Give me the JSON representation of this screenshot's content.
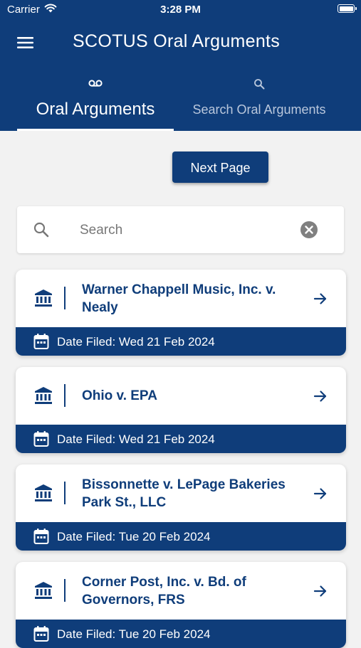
{
  "status_bar": {
    "carrier": "Carrier",
    "time": "3:28 PM"
  },
  "header": {
    "title": "SCOTUS Oral Arguments"
  },
  "tabs": [
    {
      "label": "Oral Arguments",
      "icon": "voicemail-icon",
      "active": true
    },
    {
      "label": "Search Oral Arguments",
      "icon": "search-icon",
      "active": false
    }
  ],
  "pagination": {
    "next_label": "Next Page"
  },
  "search": {
    "placeholder": "Search",
    "value": ""
  },
  "colors": {
    "primary": "#0f3d7a",
    "background": "#f2f2f2",
    "inactive_tab": "#b9c7dc"
  },
  "cases": [
    {
      "name": "Warner Chappell Music, Inc. v. Nealy",
      "date": "Date Filed: Wed 21 Feb 2024"
    },
    {
      "name": "Ohio v. EPA",
      "date": "Date Filed: Wed 21 Feb 2024"
    },
    {
      "name": "Bissonnette v. LePage Bakeries Park St., LLC",
      "date": "Date Filed: Tue 20 Feb 2024"
    },
    {
      "name": "Corner Post, Inc. v. Bd. of Governors, FRS",
      "date": "Date Filed: Tue 20 Feb 2024"
    }
  ]
}
